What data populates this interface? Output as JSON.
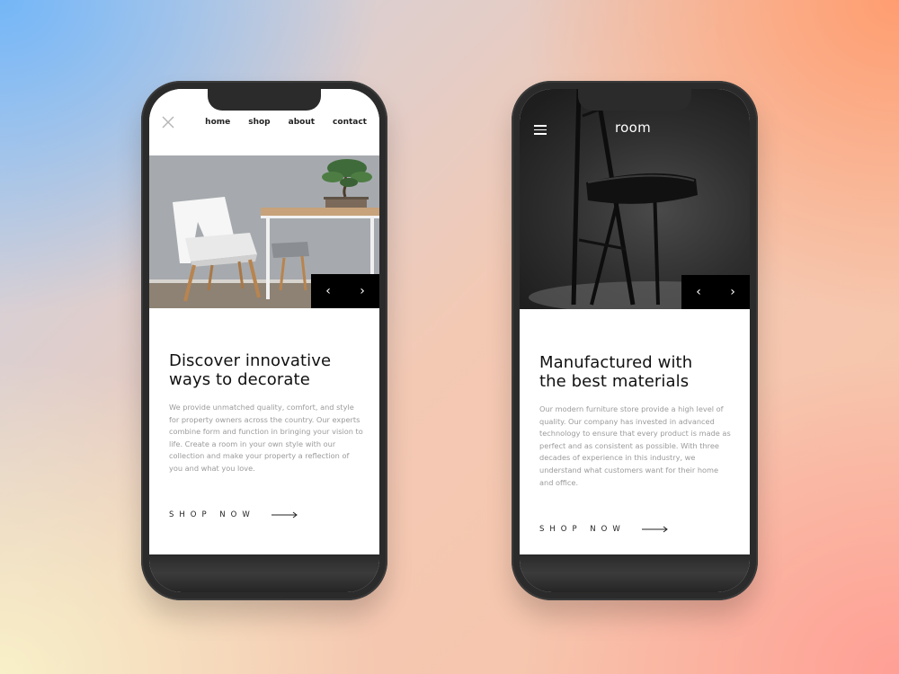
{
  "left_phone": {
    "nav": {
      "links": [
        "home",
        "shop",
        "about",
        "contact"
      ]
    },
    "hero": {
      "prev_arrow": "‹",
      "next_arrow": "›"
    },
    "headline_line1": "Discover innovative",
    "headline_line2": "ways to decorate",
    "body": "We provide unmatched quality, comfort, and style for property owners across the country. Our experts combine form and function in bringing your vision to life. Create a room in your own style with our collection and make your property a reflection of you and what you love.",
    "cta": "SHOP NOW"
  },
  "right_phone": {
    "brand": "room",
    "hero": {
      "prev_arrow": "‹",
      "next_arrow": "›"
    },
    "headline_line1": "Manufactured with",
    "headline_line2": "the best materials",
    "body": "Our modern furniture store provide a high level of quality. Our company has invested in advanced technology to ensure that every product is made as perfect and as consistent as possible. With three decades of experience in this industry, we understand what customers want for their home and office.",
    "cta": "SHOP NOW"
  },
  "colors": {
    "phone_frame": "#2b2b2b",
    "text_dark": "#111111",
    "text_muted": "#9b9b9b",
    "slider_bg": "#000000"
  },
  "icons": [
    "close-icon",
    "chevron-left-icon",
    "chevron-right-icon",
    "arrow-right-icon",
    "hamburger-menu-icon"
  ]
}
